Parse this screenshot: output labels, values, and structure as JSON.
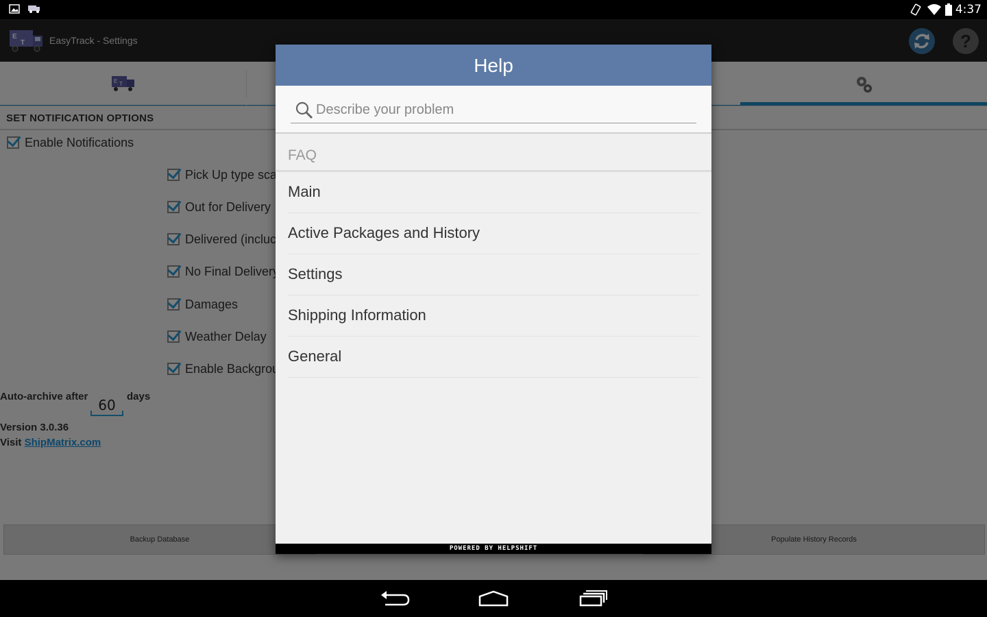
{
  "status_bar": {
    "time": "4:37"
  },
  "action_bar": {
    "title": "EasyTrack - Settings"
  },
  "settings": {
    "section_title": "SET NOTIFICATION OPTIONS",
    "enable_notifications": "Enable Notifications",
    "options": [
      "Pick Up type sca",
      "Out for Delivery",
      "Delivered (incluc",
      "No Final Delivery",
      "Damages",
      "Weather Delay",
      "Enable Backgrou"
    ],
    "archive_label": "Auto-archive after",
    "archive_value": "60",
    "archive_unit": "days",
    "version": "Version  3.0.36",
    "visit_label": "Visit ",
    "visit_link": "ShipMatrix.com",
    "backup_button": "Backup Database",
    "populate_button": "Populate History Records"
  },
  "help_dialog": {
    "title": "Help",
    "search_placeholder": "Describe your problem",
    "faq_label": "FAQ",
    "faq_items": [
      "Main",
      "Active Packages and History",
      "Settings",
      "Shipping Information",
      "General"
    ],
    "footer": "POWERED BY HELPSHIFT"
  },
  "colors": {
    "dialog_header": "#5d7ba6",
    "accent": "#1e8bc3",
    "link": "#1a8fd6"
  },
  "icons": [
    "image-icon",
    "truck-icon",
    "rotate-icon",
    "wifi-icon",
    "battery-icon",
    "sync-icon",
    "help-icon",
    "settings-gear-icon",
    "search-icon",
    "back-icon",
    "home-icon",
    "recents-icon"
  ]
}
